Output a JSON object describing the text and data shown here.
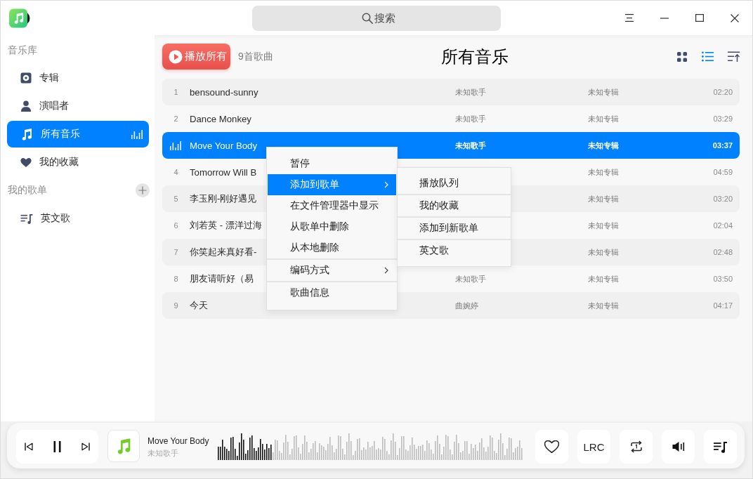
{
  "window": {
    "search": {
      "placeholder": "搜索"
    }
  },
  "sidebar": {
    "sections": [
      {
        "heading": "音乐库",
        "items": [
          {
            "kind": "album",
            "label": "专辑",
            "selected": false,
            "playing": false
          },
          {
            "kind": "artist",
            "label": "演唱者",
            "selected": false,
            "playing": false
          },
          {
            "kind": "songs",
            "label": "所有音乐",
            "selected": true,
            "playing": true
          },
          {
            "kind": "favorites",
            "label": "我的收藏",
            "selected": false,
            "playing": false
          }
        ]
      },
      {
        "heading": "我的歌单",
        "add_button": true,
        "items": [
          {
            "kind": "playlist",
            "label": "英文歌",
            "selected": false,
            "playing": false
          }
        ]
      }
    ]
  },
  "header": {
    "play_all": "播放所有",
    "count": "9首歌曲",
    "title": "所有音乐",
    "view_buttons": [
      {
        "kind": "grid",
        "selected": false
      },
      {
        "kind": "list",
        "selected": true
      }
    ]
  },
  "table": {
    "rows": [
      {
        "number": "1",
        "title": "bensound-sunny",
        "artist": "未知歌手",
        "album": "未知专辑",
        "duration": "02:20",
        "selected": false,
        "playing": false
      },
      {
        "number": "2",
        "title": "Dance Monkey",
        "artist": "未知歌手",
        "album": "未知专辑",
        "duration": "03:29",
        "selected": false,
        "playing": false
      },
      {
        "title": "Move Your Body",
        "artist": "未知歌手",
        "album": "未知专辑",
        "duration": "03:37",
        "selected": true,
        "playing": true
      },
      {
        "number": "4",
        "title": "Tomorrow Will B",
        "album": "未知专辑",
        "duration": "04:59",
        "selected": false,
        "playing": false
      },
      {
        "number": "5",
        "title": "李玉刚-刚好遇见",
        "album": "未知专辑",
        "duration": "03:20",
        "selected": false,
        "playing": false
      },
      {
        "number": "6",
        "title": "刘若英 - 漂洋过海",
        "album": "未知专辑",
        "duration": "02:04",
        "selected": false,
        "playing": false
      },
      {
        "number": "7",
        "title": "你笑起来真好看-",
        "album": "未知专辑",
        "duration": "02:48",
        "selected": false,
        "playing": false
      },
      {
        "number": "8",
        "title": "朋友请听好（易",
        "artist": "未知歌手",
        "album": "未知专辑",
        "duration": "03:50",
        "selected": false,
        "playing": false
      },
      {
        "number": "9",
        "title": "今天",
        "artist": "曲婉婷",
        "album": "未知专辑",
        "duration": "04:17",
        "selected": false,
        "playing": false
      }
    ]
  },
  "context_menu": {
    "sections": [
      {
        "items": [
          {
            "label": "暂停",
            "selected": false,
            "submenu": false
          },
          {
            "label": "添加到歌单",
            "selected": true,
            "submenu": true
          },
          {
            "label": "在文件管理器中显示",
            "selected": false,
            "submenu": false
          },
          {
            "label": "从歌单中删除",
            "selected": false,
            "submenu": false
          },
          {
            "label": "从本地删除",
            "selected": false,
            "submenu": false
          }
        ]
      },
      {
        "items": [
          {
            "label": "编码方式",
            "selected": false,
            "submenu": true
          }
        ]
      },
      {
        "items": [
          {
            "label": "歌曲信息",
            "selected": false,
            "submenu": false
          }
        ]
      }
    ],
    "submenu": {
      "items": [
        "播放队列",
        "我的收藏",
        "添加到新歌单",
        "英文歌"
      ]
    }
  },
  "player": {
    "title": "Move Your Body",
    "artist": "未知歌手",
    "playing": true,
    "level": 0.18,
    "liked": false,
    "lyrics_button": "LRC"
  }
}
